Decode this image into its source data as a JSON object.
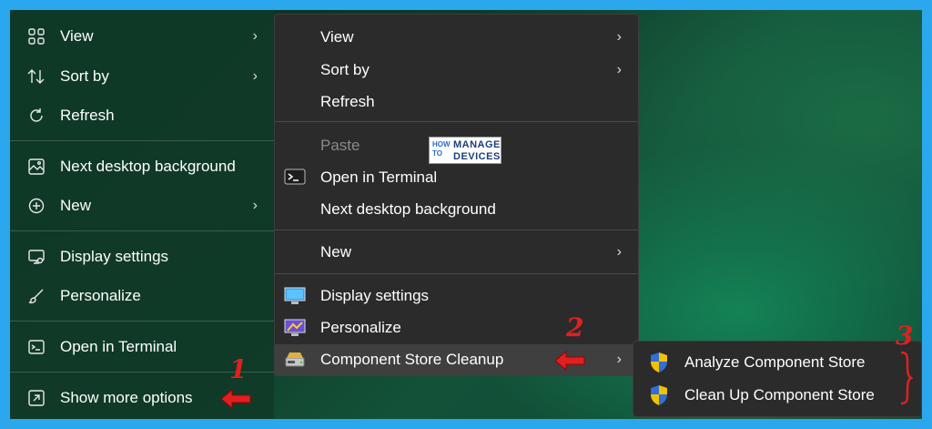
{
  "modern_menu": {
    "items": [
      {
        "label": "View",
        "icon": "grid-icon",
        "has_submenu": true
      },
      {
        "label": "Sort by",
        "icon": "sort-icon",
        "has_submenu": true
      },
      {
        "label": "Refresh",
        "icon": "refresh-icon",
        "has_submenu": false
      },
      {
        "label": "Next desktop background",
        "icon": "background-icon",
        "has_submenu": false
      },
      {
        "label": "New",
        "icon": "plus-circle-icon",
        "has_submenu": true
      },
      {
        "label": "Display settings",
        "icon": "display-icon",
        "has_submenu": false
      },
      {
        "label": "Personalize",
        "icon": "brush-icon",
        "has_submenu": false
      },
      {
        "label": "Open in Terminal",
        "icon": "terminal-icon",
        "has_submenu": false
      },
      {
        "label": "Show more options",
        "icon": "expand-icon",
        "has_submenu": false
      }
    ]
  },
  "classic_menu": {
    "items": [
      {
        "label": "View",
        "has_submenu": true
      },
      {
        "label": "Sort by",
        "has_submenu": true
      },
      {
        "label": "Refresh"
      },
      {
        "label": "Paste",
        "disabled": true
      },
      {
        "label": "Open in Terminal",
        "icon": "terminal-icon"
      },
      {
        "label": "Next desktop background"
      },
      {
        "label": "New",
        "has_submenu": true
      },
      {
        "label": "Display settings",
        "icon": "display-settings-icon"
      },
      {
        "label": "Personalize",
        "icon": "personalize-icon"
      },
      {
        "label": "Component Store Cleanup",
        "icon": "disk-cleanup-icon",
        "has_submenu": true,
        "highlighted": true
      }
    ]
  },
  "submenu": {
    "items": [
      {
        "label": "Analyze Component Store",
        "icon": "uac-shield-icon"
      },
      {
        "label": "Clean Up Component Store",
        "icon": "uac-shield-icon"
      }
    ]
  },
  "annotations": {
    "step1": "1",
    "step2": "2",
    "step3": "3"
  },
  "watermark": {
    "how": "HOW",
    "to": "TO",
    "manage": "MANAGE",
    "devices": "DEVICES"
  },
  "colors": {
    "annotation": "#e02020",
    "frame_border": "#2ba7ee",
    "menu_bg": "#2b2b2b"
  }
}
